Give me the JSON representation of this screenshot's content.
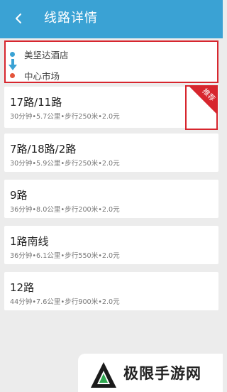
{
  "header": {
    "title": "线路详情",
    "title_visible": "线路详情",
    "back_icon": "back-arrow-icon",
    "bg_color": "#3aa2d4"
  },
  "route": {
    "from": "美坚达酒店",
    "to": "中心市场",
    "start_dot_color": "#3aa2d4",
    "end_dot_color": "#e4553b"
  },
  "plans": [
    {
      "name": "17路/11路",
      "meta": "30分钟•5.7公里•步行250米•2.0元",
      "recommended": true
    },
    {
      "name": "7路/18路/2路",
      "meta": "30分钟•5.9公里•步行250米•2.0元",
      "recommended": false
    },
    {
      "name": "9路",
      "meta": "36分钟•8.0公里•步行200米•2.0元",
      "recommended": false
    },
    {
      "name": "1路南线",
      "meta": "36分钟•6.1公里•步行550米•2.0元",
      "recommended": false
    },
    {
      "name": "12路",
      "meta": "44分钟•7.6公里•步行900米•2.0元",
      "recommended": false
    }
  ],
  "recommend_badge": {
    "label": "推荐",
    "color": "#d7262e"
  },
  "watermark": {
    "text": "极限手游网",
    "logo": "site-logo-icon"
  },
  "highlight_color": "#d7262e"
}
